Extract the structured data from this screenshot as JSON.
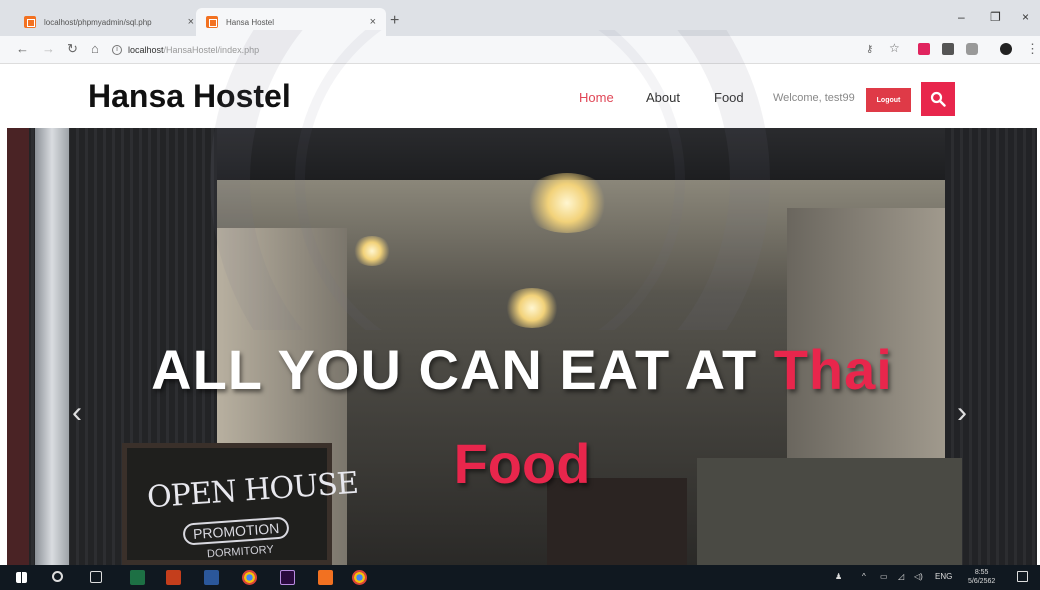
{
  "browser": {
    "tabs": [
      {
        "label": "localhost/phpmyadmin/sql.php"
      },
      {
        "label": "Hansa Hostel"
      }
    ],
    "address": {
      "host": "localhost",
      "path": "/HansaHostel/index.php"
    },
    "new_tab_glyph": "+",
    "window_controls": [
      "–",
      "❐",
      "×"
    ],
    "tab_close_glyph": "×"
  },
  "site": {
    "brand": "Hansa Hostel",
    "nav": [
      {
        "label": "Home",
        "active": true
      },
      {
        "label": "About",
        "active": false
      },
      {
        "label": "Food",
        "active": false
      }
    ],
    "welcome": "Welcome, test99",
    "logout_label": "Logout",
    "accent_color": "#e8264c"
  },
  "hero": {
    "headline_main": "ALL YOU CAN EAT AT ",
    "headline_highlight": "Thai",
    "headline_second": "Food",
    "board_line1": "OPEN HOUSE",
    "board_line2": "PROMOTION",
    "board_line3": "DORMITORY",
    "prev_glyph": "‹",
    "next_glyph": "›"
  },
  "taskbar": {
    "lang": "ENG",
    "time": "8:55",
    "date": "5/6/2562"
  }
}
